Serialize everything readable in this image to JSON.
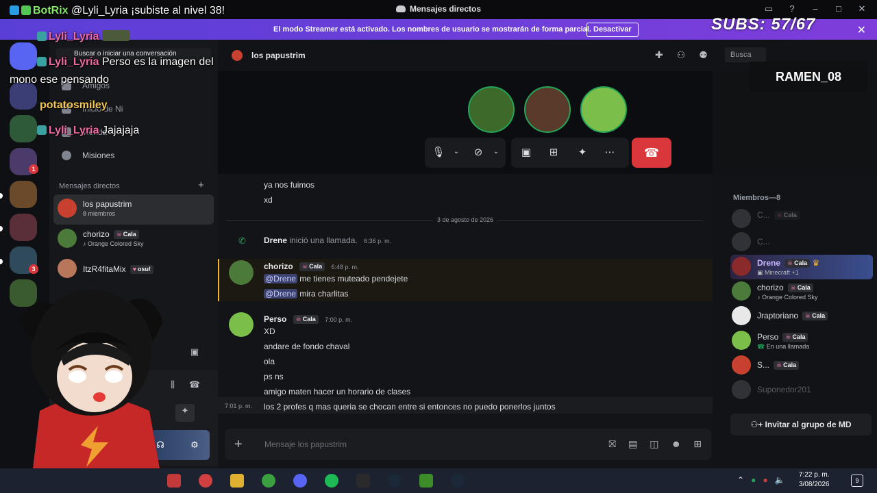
{
  "window": {
    "title": "Mensajes directos"
  },
  "banner": {
    "message": "El modo Streamer está activado. Los nombres de usuario se mostrarán de forma parcial.",
    "button": "Desactivar"
  },
  "stream": {
    "subs": "SUBS: 57/67",
    "streamer": "RAMEN_08"
  },
  "overlay": {
    "lines": [
      {
        "user": "BotRix",
        "text": "@Lyli_Lyria ¡subiste al nivel 38!"
      },
      {
        "user": "Lyli_Lyria",
        "text": ""
      },
      {
        "user": "Lyli_Lyria",
        "text": "Perso es la imagen del"
      },
      {
        "user": "",
        "text": "mono ese pensando"
      },
      {
        "user": "potatosmiley",
        "text": ""
      },
      {
        "user": "Lyli_Lyria",
        "text": "Jajajaja"
      }
    ]
  },
  "sidebar": {
    "search_placeholder": "Buscar o iniciar una conversación",
    "friends": "Amigos",
    "nitro": "Inicio de Ni",
    "tienda": "Tienda",
    "quests": "Misiones",
    "dm_header": "Mensajes directos",
    "dms": [
      {
        "name": "los papustrim",
        "sub": "8 miembros",
        "tag": ""
      },
      {
        "name": "chorizo",
        "sub": "Orange Colored Sky",
        "tag": "Cala"
      },
      {
        "name": "ItzR4fitaMix",
        "sub": "",
        "tag": "osu!"
      }
    ]
  },
  "header": {
    "channel": "los papustrim",
    "search": "Busca"
  },
  "messages": {
    "pre": [
      "ya nos fuimos",
      "xd"
    ],
    "divider": "3 de agosto de 2026",
    "call": {
      "user": "Drene",
      "text": "inició una llamada.",
      "time": "6:36 p. m."
    },
    "chorizo": {
      "author": "chorizo",
      "tag": "Cala",
      "time": "6:48 p. m.",
      "lines": [
        {
          "mention": "@Drene",
          "text": " me tienes muteado pendejete"
        },
        {
          "mention": "@Drene",
          "text": " mira charlitas"
        }
      ]
    },
    "perso": {
      "author": "Perso",
      "tag": "Cala",
      "time": "7:00 p. m.",
      "lines": [
        "XD",
        "andare de fondo chaval",
        "ola",
        "ps ns",
        "amigo maten hacer un horario de clases"
      ]
    },
    "last": {
      "time": "7:01 p. m.",
      "text": "los 2 profes q mas queria se chocan entre si entonces no puedo ponerlos juntos"
    }
  },
  "composer": {
    "placeholder": "Mensaje los papustrim"
  },
  "members": {
    "header": "Miembros—8",
    "list": [
      {
        "name": "C...",
        "tag": "Cala",
        "status": "",
        "dim": true
      },
      {
        "name": "C...",
        "tag": "",
        "status": "",
        "dim": true
      },
      {
        "name": "Drene",
        "tag": "Cala",
        "status": "Minecraft +1",
        "dim": false
      },
      {
        "name": "chorizo",
        "tag": "Cala",
        "status": "Orange Colored Sky",
        "dim": false
      },
      {
        "name": "Jraptoriano",
        "tag": "Cala",
        "status": "",
        "dim": false
      },
      {
        "name": "Perso",
        "tag": "Cala",
        "status": "En una llamada",
        "dim": false
      },
      {
        "name": "S...",
        "tag": "Cala",
        "status": "",
        "dim": false
      },
      {
        "name": "Suponedor201",
        "tag": "",
        "status": "",
        "dim": true
      }
    ],
    "invite": "Invitar al grupo de MD"
  },
  "taskbar": {
    "time": "7:22 p. m.",
    "date": "3/08/2026",
    "notifications": "9"
  }
}
